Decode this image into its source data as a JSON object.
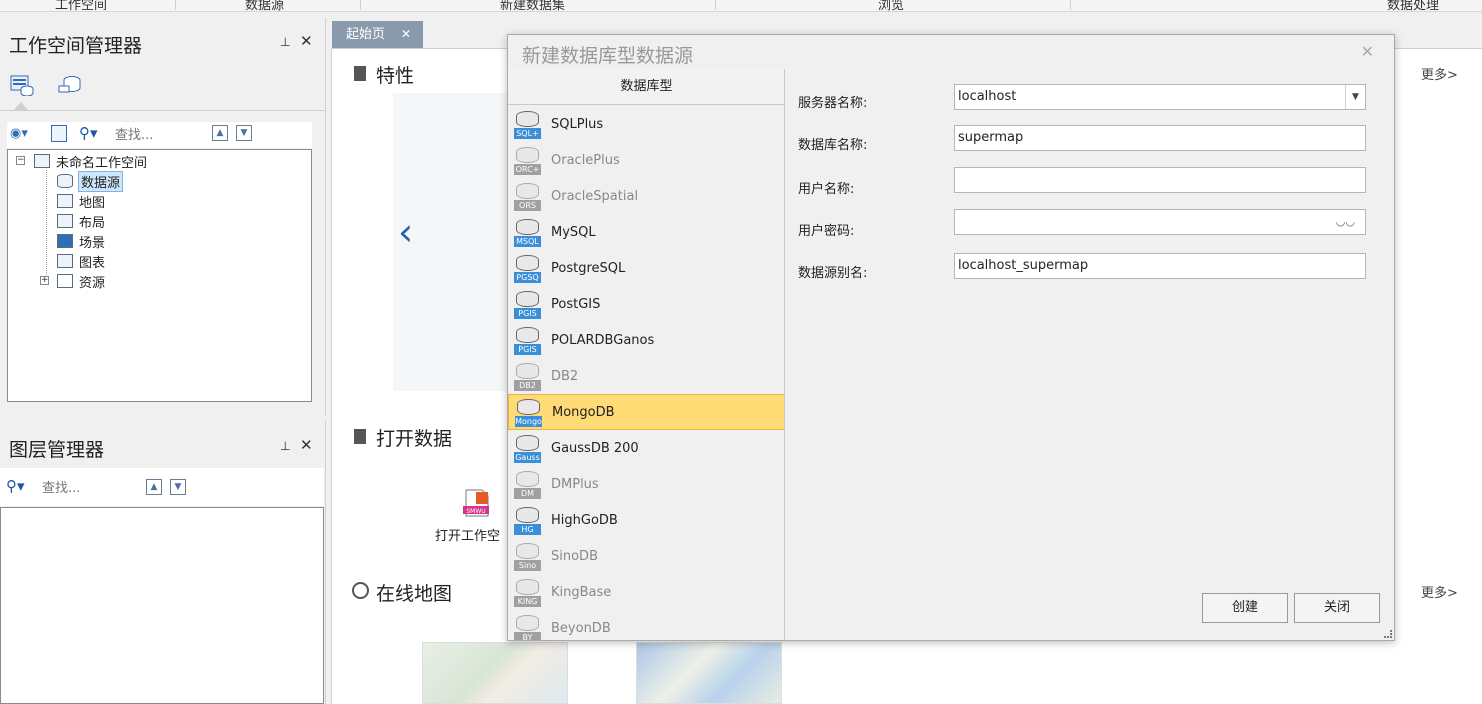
{
  "ribbon": {
    "groups": [
      "工作空间",
      "数据源",
      "新建数据集",
      "浏览",
      "数据处理"
    ]
  },
  "workspace_manager": {
    "title": "工作空间管理器",
    "search_placeholder": "查找...",
    "tree": {
      "root": "未命名工作空间",
      "children": [
        "数据源",
        "地图",
        "布局",
        "场景",
        "图表",
        "资源"
      ]
    }
  },
  "layer_manager": {
    "title": "图层管理器",
    "search_placeholder": "查找..."
  },
  "start_page": {
    "tab_label": "起始页",
    "features_title": "特性",
    "open_data_title": "打开数据",
    "open_workspace_label": "打开工作空",
    "online_map_title": "在线地图",
    "more_label": "更多>"
  },
  "dialog": {
    "title": "新建数据库型数据源",
    "list_header": "数据库型",
    "db_types": [
      {
        "label": "SQLPlus",
        "tag": "SQL+",
        "enabled": true
      },
      {
        "label": "OraclePlus",
        "tag": "ORC+",
        "enabled": false
      },
      {
        "label": "OracleSpatial",
        "tag": "ORS",
        "enabled": false
      },
      {
        "label": "MySQL",
        "tag": "MSQL",
        "enabled": true
      },
      {
        "label": "PostgreSQL",
        "tag": "PGSQ",
        "enabled": true
      },
      {
        "label": "PostGIS",
        "tag": "PGIS",
        "enabled": true
      },
      {
        "label": "POLARDBGanos",
        "tag": "PGIS",
        "enabled": true
      },
      {
        "label": "DB2",
        "tag": "DB2",
        "enabled": false
      },
      {
        "label": "MongoDB",
        "tag": "Mongo",
        "enabled": true,
        "selected": true
      },
      {
        "label": "GaussDB 200",
        "tag": "Gauss",
        "enabled": true
      },
      {
        "label": "DMPlus",
        "tag": "DM",
        "enabled": false
      },
      {
        "label": "HighGoDB",
        "tag": "HG",
        "enabled": true
      },
      {
        "label": "SinoDB",
        "tag": "Sino",
        "enabled": false
      },
      {
        "label": "KingBase",
        "tag": "KING",
        "enabled": false
      },
      {
        "label": "BeyonDB",
        "tag": "BY",
        "enabled": false
      }
    ],
    "fields": {
      "server_label": "服务器名称:",
      "server_value": "localhost",
      "database_label": "数据库名称:",
      "database_value": "supermap",
      "user_label": "用户名称:",
      "user_value": "",
      "password_label": "用户密码:",
      "password_value": "",
      "alias_label": "数据源别名:",
      "alias_value": "localhost_supermap"
    },
    "create_label": "创建",
    "close_label": "关闭"
  },
  "colors": {
    "selected_item": "#fedb75",
    "tab_bg": "#8a9aad",
    "accent": "#2a5fb0"
  }
}
